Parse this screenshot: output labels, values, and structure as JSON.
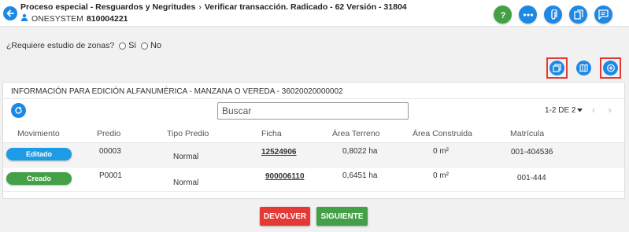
{
  "header": {
    "breadcrumb": [
      "Proceso especial - Resguardos y Negritudes",
      "Verificar transacción. Radicado - 62 Versión - 31804"
    ],
    "system": "ONESYSTEM",
    "code": "810004221",
    "icons": [
      "back-arrow-icon",
      "help-icon",
      "more-icon",
      "attach-icon",
      "document-icon",
      "comments-icon"
    ]
  },
  "zonas": {
    "question": "¿Requiere estudio de zonas?",
    "options": [
      "Si",
      "No"
    ]
  },
  "actions": {
    "icons": [
      "layers-icon",
      "map-icon",
      "add-comment-icon"
    ]
  },
  "panel": {
    "title": "INFORMACIÓN PARA EDICIÓN ALFANUMÉRICA - MANZANA O VEREDA - 36020020000002",
    "search_placeholder": "Buscar",
    "pager": "1-2 DE 2",
    "columns": [
      "Movimiento",
      "Predio",
      "Tipo Predio",
      "Ficha",
      "Área Terreno",
      "Área Construida",
      "Matrícula"
    ],
    "rows": [
      {
        "movimiento": "Editado",
        "predio": "00003",
        "tipo": "Normal",
        "ficha": "12524906",
        "area_terreno": "0,8022 ha",
        "area_construida": "0 m²",
        "matricula": "001-404536"
      },
      {
        "movimiento": "Creado",
        "predio": "P0001",
        "tipo": "Normal",
        "ficha": "900006110",
        "area_terreno": "0,6451 ha",
        "area_construida": "0 m²",
        "matricula": "001-444"
      }
    ]
  },
  "buttons": {
    "devolver": "DEVOLVER",
    "siguiente": "SIGUIENTE"
  },
  "colors": {
    "primary": "#1e88e5",
    "success": "#43a047",
    "danger": "#e53935"
  }
}
